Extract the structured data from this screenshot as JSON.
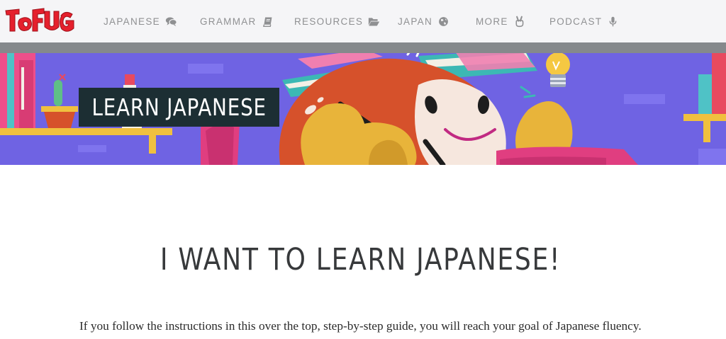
{
  "brand": {
    "logo_text": "TOFUGU",
    "logo_color": "#e5202d"
  },
  "nav": {
    "items": [
      {
        "label": "JAPANESE",
        "icon": "speech-bubbles-icon"
      },
      {
        "label": "GRAMMAR",
        "icon": "book-icon"
      },
      {
        "label": "RESOURCES",
        "icon": "folder-open-icon"
      },
      {
        "label": "JAPAN",
        "icon": "globe-icon"
      },
      {
        "label": "MORE",
        "icon": "peace-hand-icon"
      },
      {
        "label": "PODCAST",
        "icon": "microphone-icon"
      }
    ]
  },
  "hero": {
    "title": "LEARN JAPANESE",
    "background_color": "#6f63e3",
    "illustration": "tofu-mascot-reading-icon"
  },
  "main": {
    "heading": "I WANT TO LEARN JAPANESE!",
    "intro": "If you follow the instructions in this over the top, step-by-step guide, you will reach your goal of Japanese fluency."
  },
  "colors": {
    "nav_bg": "#f5f5f7",
    "nav_text": "#8f9092",
    "divider": "#85898c",
    "title_box": "#1c2e33",
    "accent_red": "#e5202d",
    "mascot_orange": "#d6512b"
  }
}
